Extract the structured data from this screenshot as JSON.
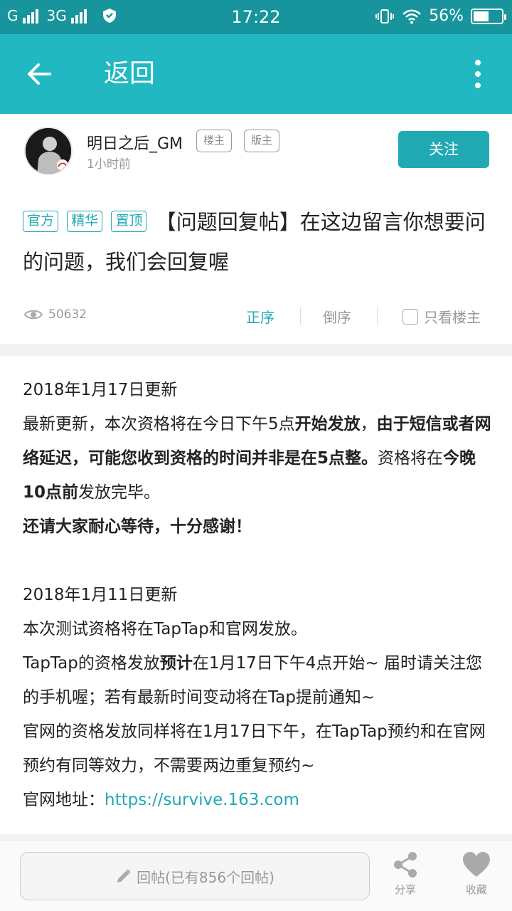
{
  "status_bar": {
    "carrier1": "G",
    "carrier2": "3G",
    "time": "17:22",
    "battery": "56%",
    "battery_level": 0.56
  },
  "app_bar": {
    "title": "返回",
    "back_icon": "arrow-left-icon",
    "more_icon": "more-vertical-icon"
  },
  "author": {
    "name": "明日之后_GM",
    "badges": [
      "楼主",
      "版主"
    ],
    "time": "1小时前",
    "follow_label": "关注"
  },
  "post": {
    "tags": [
      "官方",
      "精华",
      "置顶"
    ],
    "title": "【问题回复帖】在这边留言你想要问的问题，我们会回复喔"
  },
  "meta": {
    "views": "50632",
    "sort_asc": "正序",
    "sort_desc": "倒序",
    "only_op": "只看楼主"
  },
  "content": {
    "update1_date": "2018年1月17日更新",
    "u1_a": "最新更新，本次资格将在今日下午5点",
    "u1_b": "开始发放",
    "u1_c": "，",
    "u1_d": "由于短信或者网络延迟，可能您收到资格的时间并非是在5点整。",
    "u1_e": "资格将在",
    "u1_f": "今晚10点前",
    "u1_g": "发放完毕。",
    "u1_h": "还请大家耐心等待，十分感谢！",
    "update2_date": "2018年1月11日更新",
    "u2_a": "本次测试资格将在TapTap和官网发放。",
    "u2_b": "TapTap的资格发放",
    "u2_c": "预计",
    "u2_d": "在1月17日下午4点开始~ 届时请关注您的手机喔；若有最新时间变动将在Tap提前通知~",
    "u2_e": "官网的资格发放同样将在1月17日下午，在TapTap预约和在官网预约有同等效力，不需要两边重复预约~",
    "u2_f": "官网地址：",
    "u2_link": "https://survive.163.com"
  },
  "bottom_bar": {
    "reply_placeholder": "回帖(已有856个回帖)",
    "share_label": "分享",
    "favorite_label": "收藏"
  }
}
